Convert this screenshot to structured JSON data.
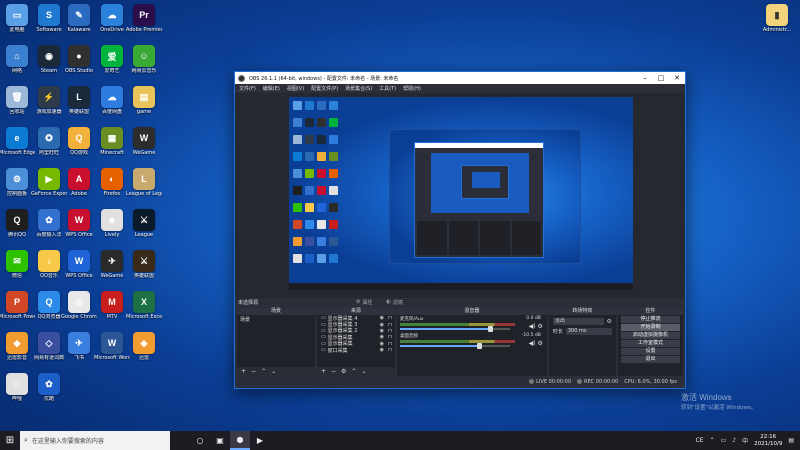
{
  "desktop_icons": [
    {
      "label": "此电脑",
      "color": "#5aa0e6",
      "glyph": "▭"
    },
    {
      "label": "Softaware",
      "color": "#1f79d0",
      "glyph": "S"
    },
    {
      "label": "Kalaware",
      "color": "#2b6cc0",
      "glyph": "✎"
    },
    {
      "label": "OneDrive",
      "color": "#2a82da",
      "glyph": "☁"
    },
    {
      "label": "Adobe Premiere",
      "color": "#2a0e4a",
      "glyph": "Pr"
    },
    {
      "label": "网络",
      "color": "#3b7fd0",
      "glyph": "⌂"
    },
    {
      "label": "Steam",
      "color": "#1b2838",
      "glyph": "◉"
    },
    {
      "label": "OBS Studio",
      "color": "#303030",
      "glyph": "●"
    },
    {
      "label": "爱奇艺",
      "color": "#00b33c",
      "glyph": "爱"
    },
    {
      "label": "网易云音乐",
      "color": "#3aaa35",
      "glyph": "☺"
    },
    {
      "label": "回收站",
      "color": "#9cb8d8",
      "glyph": "🗑"
    },
    {
      "label": "游戏加速器",
      "color": "#2c3a4a",
      "glyph": "⚡"
    },
    {
      "label": "英雄联盟",
      "color": "#1a2a3a",
      "glyph": "L"
    },
    {
      "label": "百度网盘",
      "color": "#2f7ce0",
      "glyph": "☁"
    },
    {
      "label": "game",
      "color": "#e8c45a",
      "glyph": "▤"
    },
    {
      "label": "Microsoft Edge",
      "color": "#0c7bd4",
      "glyph": "e"
    },
    {
      "label": "阿里旺旺",
      "color": "#2a6ab0",
      "glyph": "✪"
    },
    {
      "label": "QQ游戏",
      "color": "#f2b13a",
      "glyph": "Q"
    },
    {
      "label": "Minecraft",
      "color": "#6b8e23",
      "glyph": "▦"
    },
    {
      "label": "WeGame",
      "color": "#2d2d2d",
      "glyph": "W"
    },
    {
      "label": "控制面板",
      "color": "#4a8fd8",
      "glyph": "⚙"
    },
    {
      "label": "GeForce Experience",
      "color": "#76b900",
      "glyph": "▶"
    },
    {
      "label": "Adobe",
      "color": "#c8102e",
      "glyph": "A"
    },
    {
      "label": "Firefox",
      "color": "#e66000",
      "glyph": "◐"
    },
    {
      "label": "League of Legends",
      "color": "#c8aa6e",
      "glyph": "L"
    },
    {
      "label": "腾讯QQ",
      "color": "#1e1e1e",
      "glyph": "Q"
    },
    {
      "label": "百度输入法",
      "color": "#3270d0",
      "glyph": "✿"
    },
    {
      "label": "WPS Office",
      "color": "#c8102e",
      "glyph": "W"
    },
    {
      "label": "Lively",
      "color": "#e0e0e0",
      "glyph": "☻"
    },
    {
      "label": "League",
      "color": "#0a1a2a",
      "glyph": "⚔"
    },
    {
      "label": "微信",
      "color": "#2dc100",
      "glyph": "✉"
    },
    {
      "label": "QQ音乐",
      "color": "#f7c948",
      "glyph": "♪"
    },
    {
      "label": "WPS Office",
      "color": "#1e64d8",
      "glyph": "W"
    },
    {
      "label": "WeGame",
      "color": "#2a2a2a",
      "glyph": "✈"
    },
    {
      "label": "英雄联盟",
      "color": "#3a2a1a",
      "glyph": "⚔"
    },
    {
      "label": "Microsoft PowerPoint",
      "color": "#d24726",
      "glyph": "P"
    },
    {
      "label": "QQ浏览器",
      "color": "#2c8be8",
      "glyph": "Q"
    },
    {
      "label": "Google Chrome",
      "color": "#e8e8e8",
      "glyph": "◎"
    },
    {
      "label": "MTV",
      "color": "#c81e1e",
      "glyph": "M"
    },
    {
      "label": "Microsoft Excel",
      "color": "#1d7044",
      "glyph": "X"
    },
    {
      "label": "迅雷影音",
      "color": "#f29b30",
      "glyph": "◆"
    },
    {
      "label": "网易有道词典",
      "color": "#3a4fa0",
      "glyph": "◇"
    },
    {
      "label": "飞书",
      "color": "#3a7fe0",
      "glyph": "✈"
    },
    {
      "label": "Microsoft Word",
      "color": "#2b5797",
      "glyph": "W"
    },
    {
      "label": "迅雷",
      "color": "#f29b30",
      "glyph": "◆"
    },
    {
      "label": "哔哩",
      "color": "#e0e0e0",
      "glyph": "☺"
    },
    {
      "label": "优酷",
      "color": "#1c5fc8",
      "glyph": "✿"
    }
  ],
  "obs": {
    "title": "OBS 26.1.1 (64-bit, windows) - 配置文件: 未命名 - 场景: 未命名",
    "menu": [
      "文件(F)",
      "编辑(E)",
      "视图(V)",
      "配置文件(P)",
      "场景集合(S)",
      "工具(T)",
      "帮助(H)"
    ],
    "source_bar": {
      "no_source": "未选择源",
      "props": "属性",
      "filters": "滤镜"
    },
    "docks": {
      "scenes_title": "场景",
      "sources_title": "来源",
      "mixer_title": "混音器",
      "transitions_title": "转场特效",
      "controls_title": "控件"
    },
    "scenes": [
      "场景"
    ],
    "sources": [
      "显示器采集 4",
      "显示器采集 3",
      "显示器采集 2",
      "显示器采集",
      "显示器采集",
      "窗口采集"
    ],
    "mixer": [
      {
        "name": "麦克风/Aux",
        "db": "0.0 dB",
        "level": 0.82
      },
      {
        "name": "桌面音频",
        "db": "-10.5 dB",
        "level": 0.72
      }
    ],
    "transition": {
      "type": "淡出",
      "duration_label": "时长",
      "duration_value": "300 ms"
    },
    "controls": [
      "停止推流",
      "开始录制",
      "启动虚拟摄像机",
      "工作室模式",
      "设置",
      "退出"
    ],
    "status": {
      "live_label": "LIVE",
      "live_time": "00:00:00",
      "rec_label": "REC",
      "rec_time": "00:00:00",
      "cpu": "CPU: 6.0%, 30.00 fps"
    }
  },
  "taskbar": {
    "search_placeholder": "在这里输入你要搜索的内容",
    "clock_time": "22:16",
    "clock_date": "2021/10/9",
    "ime": "中",
    "tray_label": "CE"
  },
  "watermark": {
    "line1": "激活 Windows",
    "line2": "转到\"设置\"以激活 Windows。"
  },
  "recycle_bin_label": "Administr..."
}
